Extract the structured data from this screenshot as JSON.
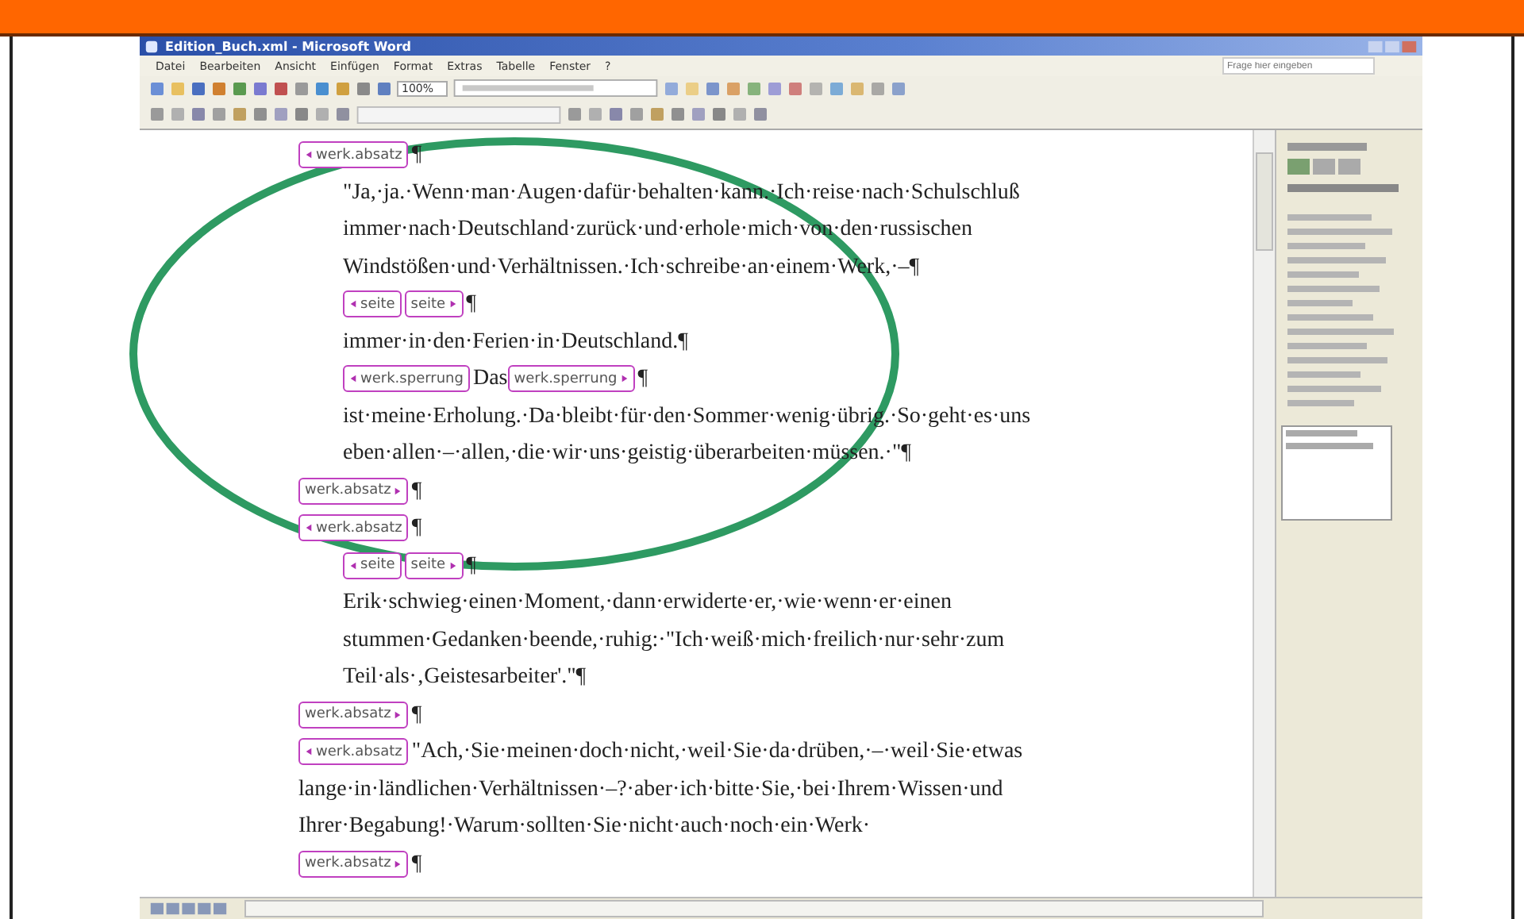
{
  "window": {
    "title": "Edition_Buch.xml - Microsoft Word",
    "menu": [
      "Datei",
      "Bearbeiten",
      "Ansicht",
      "Einfügen",
      "Format",
      "Extras",
      "Tabelle",
      "Fenster",
      "?"
    ],
    "zoom": "100%",
    "help_box": {
      "placeholder": "Frage hier eingeben"
    },
    "document": {
      "blocks": [
        {
          "kind": "tags",
          "items": [
            {
              "kind": "start",
              "text": "werk.absatz"
            },
            {
              "kind": "text",
              "text": "¶"
            }
          ],
          "children": [
            {
              "kind": "text",
              "lines": [
                "\"Ja,·ja.·Wenn·man·Augen·dafür·behalten·kann.·Ich·reise·nach·Schulschluß",
                "immer·nach·Deutschland·zurück·und·erhole·mich·von·den·russischen",
                "Windstößen·und·Verhältnissen.·Ich·schreibe·an·einem·Werk,·–¶"
              ]
            },
            {
              "kind": "tags",
              "items": [
                {
                  "kind": "start",
                  "text": "seite"
                },
                {
                  "kind": "end",
                  "text": "seite"
                },
                {
                  "kind": "text",
                  "text": "¶"
                }
              ]
            },
            {
              "kind": "text",
              "lines": [
                "immer·in·den·Ferien·in·Deutschland.¶"
              ]
            },
            {
              "kind": "tags",
              "items": [
                {
                  "kind": "start",
                  "text": "werk.sperrung"
                },
                {
                  "kind": "text",
                  "text": "Das"
                },
                {
                  "kind": "end",
                  "text": "werk.sperrung"
                },
                {
                  "kind": "text",
                  "text": "¶"
                }
              ]
            },
            {
              "kind": "text",
              "lines": [
                "ist·meine·Erholung.·Da·bleibt·für·den·Sommer·wenig·übrig.·So·geht·es·uns",
                "eben·allen·–·allen,·die·wir·uns·geistig·überarbeiten·müssen.·\"¶"
              ]
            }
          ]
        },
        {
          "kind": "tags",
          "items": [
            {
              "kind": "end",
              "text": "werk.absatz"
            },
            {
              "kind": "text",
              "text": "¶"
            }
          ]
        },
        {
          "kind": "tags",
          "items": [
            {
              "kind": "start",
              "text": "werk.absatz"
            },
            {
              "kind": "text",
              "text": "¶"
            }
          ],
          "children": [
            {
              "kind": "tags",
              "items": [
                {
                  "kind": "start",
                  "text": "seite"
                },
                {
                  "kind": "end",
                  "text": "seite"
                },
                {
                  "kind": "text",
                  "text": "¶"
                }
              ]
            },
            {
              "kind": "text",
              "lines": [
                "Erik·schwieg·einen·Moment,·dann·erwiderte·er,·wie·wenn·er·einen",
                "stummen·Gedanken·beende,·ruhig:·\"Ich·weiß·mich·freilich·nur·sehr·zum",
                "Teil·als·‚Geistesarbeiter'.\"¶"
              ]
            }
          ]
        },
        {
          "kind": "tags",
          "items": [
            {
              "kind": "end",
              "text": "werk.absatz"
            },
            {
              "kind": "text",
              "text": "¶"
            }
          ]
        },
        {
          "kind": "tags",
          "items": [
            {
              "kind": "start",
              "text": "werk.absatz"
            },
            {
              "kind": "text",
              "text": "\"Ach,·Sie·meinen·doch·nicht,·weil·Sie·da·drüben,·–·weil·Sie·etwas"
            }
          ]
        },
        {
          "kind": "text",
          "lines": [
            "lange·in·ländlichen·Verhältnissen·–?·aber·ich·bitte·Sie,·bei·Ihrem·Wissen·und",
            "Ihrer·Begabung!·Warum·sollten·Sie·nicht·auch·noch·ein·Werk·"
          ]
        },
        {
          "kind": "tags",
          "items": [
            {
              "kind": "end",
              "text": "werk.absatz"
            },
            {
              "kind": "text",
              "text": "¶"
            }
          ]
        }
      ]
    }
  }
}
